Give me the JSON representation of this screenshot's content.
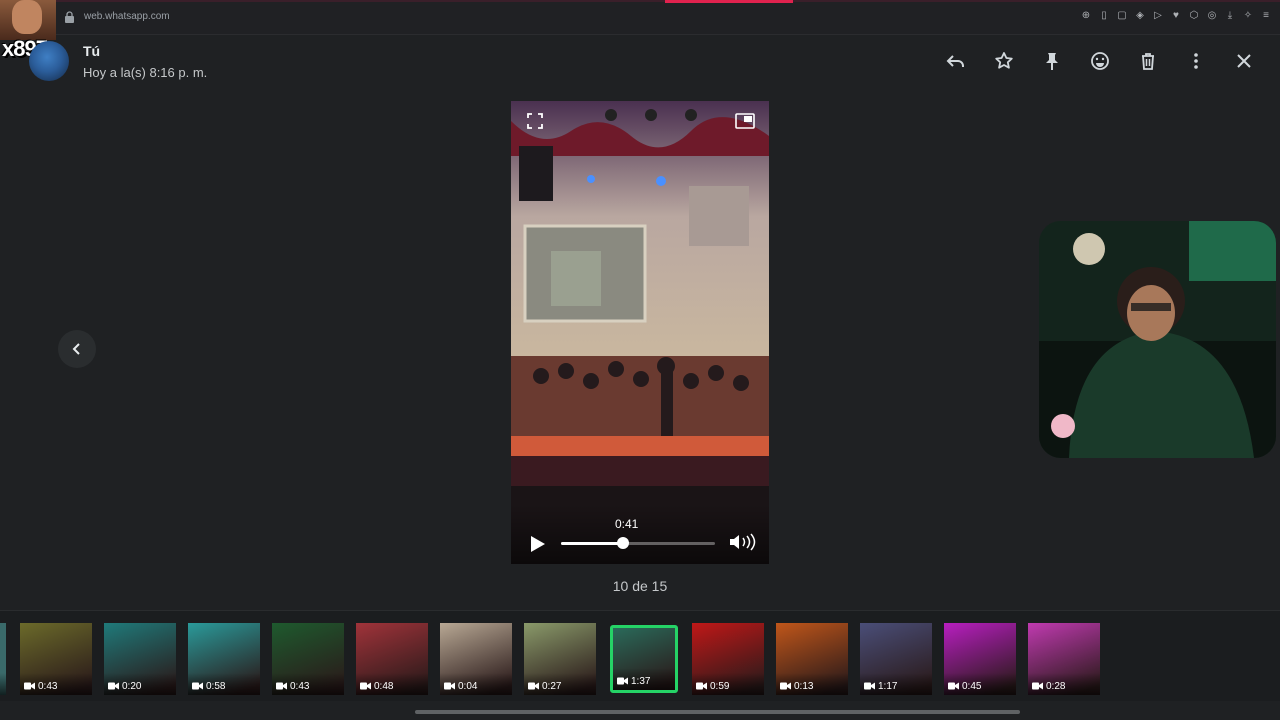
{
  "browser": {
    "url": "web.whatsapp.com"
  },
  "overlay": {
    "tag": "x897"
  },
  "header": {
    "sender_name": "Tú",
    "timestamp": "Hoy a la(s) 8:16 p. m.",
    "actions": [
      "reply-icon",
      "star-icon",
      "pin-icon",
      "emoji-icon",
      "trash-icon",
      "more-vert-icon",
      "close-icon"
    ]
  },
  "video": {
    "current_time": "0:41",
    "progress": 0.4
  },
  "counter": "10 de 15",
  "thumbnails": [
    {
      "duration": "0:43",
      "tone": "#6b6a2a"
    },
    {
      "duration": "0:20",
      "tone": "#1f7a7a"
    },
    {
      "duration": "0:58",
      "tone": "#2a9a9a"
    },
    {
      "duration": "0:43",
      "tone": "#1e5a2e"
    },
    {
      "duration": "0:48",
      "tone": "#a0333a"
    },
    {
      "duration": "0:04",
      "tone": "#b8a894"
    },
    {
      "duration": "0:27",
      "tone": "#8a9a6a"
    },
    {
      "duration": "1:37",
      "tone": "#2a6a5a",
      "active": true
    },
    {
      "duration": "0:59",
      "tone": "#c01818"
    },
    {
      "duration": "0:13",
      "tone": "#c0561a"
    },
    {
      "duration": "1:17",
      "tone": "#4a4e78"
    },
    {
      "duration": "0:45",
      "tone": "#b81ec0"
    },
    {
      "duration": "0:28",
      "tone": "#c03ab0"
    }
  ]
}
